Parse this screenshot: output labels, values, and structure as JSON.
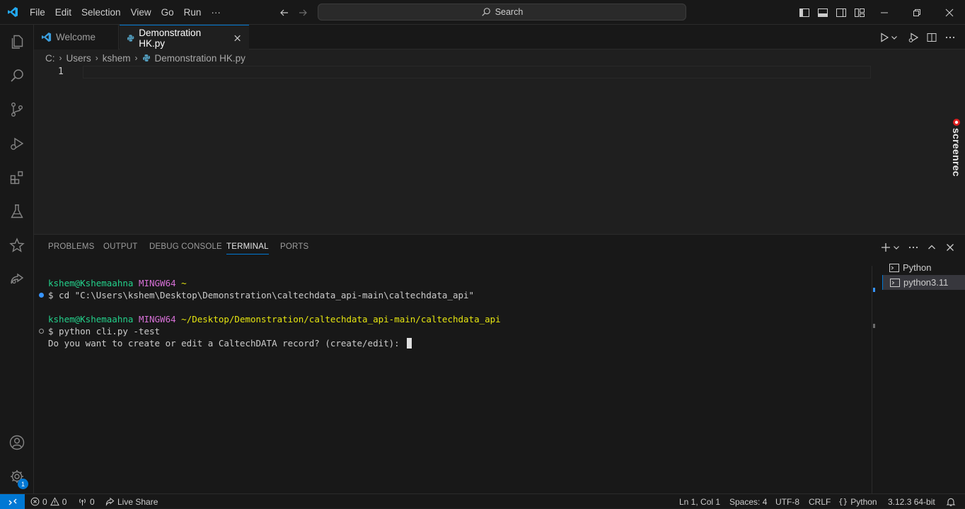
{
  "menu": [
    "File",
    "Edit",
    "Selection",
    "View",
    "Go",
    "Run",
    "···"
  ],
  "search": {
    "label": "Search"
  },
  "tabs": [
    {
      "label": "Welcome"
    },
    {
      "label": "Demonstration HK.py"
    }
  ],
  "breadcrumb": [
    "C:",
    "Users",
    "kshem",
    "Demonstration HK.py"
  ],
  "editor": {
    "line_number": "1"
  },
  "panel": {
    "tabs": [
      "PROBLEMS",
      "OUTPUT",
      "DEBUG CONSOLE",
      "TERMINAL",
      "PORTS"
    ],
    "active_tab": "TERMINAL"
  },
  "terminal": {
    "line1_user": "kshem@Kshemaahna",
    "line1_host": "MINGW64",
    "line1_path": "~",
    "line2": "$ cd \"C:\\Users\\kshem\\Desktop\\Demonstration\\caltechdata_api-main\\caltechdata_api\"",
    "line3_user": "kshem@Kshemaahna",
    "line3_host": "MINGW64",
    "line3_path": "~/Desktop/Demonstration/caltechdata_api-main/caltechdata_api",
    "line4": "$ python cli.py -test",
    "line5": "Do you want to create or edit a CaltechDATA record? (create/edit): "
  },
  "terminal_list": [
    "Python",
    "python3.11"
  ],
  "screenrec_label": "screenrec",
  "status": {
    "errors": "0",
    "warnings": "0",
    "ports": "0",
    "live_share": "Live Share",
    "position": "Ln 1, Col 1",
    "spaces": "Spaces: 4",
    "encoding": "UTF-8",
    "eol": "CRLF",
    "language": "Python",
    "interpreter": "3.12.3 64-bit"
  },
  "settings_badge": "1",
  "colors": {
    "accent": "#0078d4",
    "terminal_green": "#23d18b",
    "terminal_magenta": "#d670d6",
    "terminal_yellow": "#e5e510",
    "python_icon": "#519aba"
  }
}
